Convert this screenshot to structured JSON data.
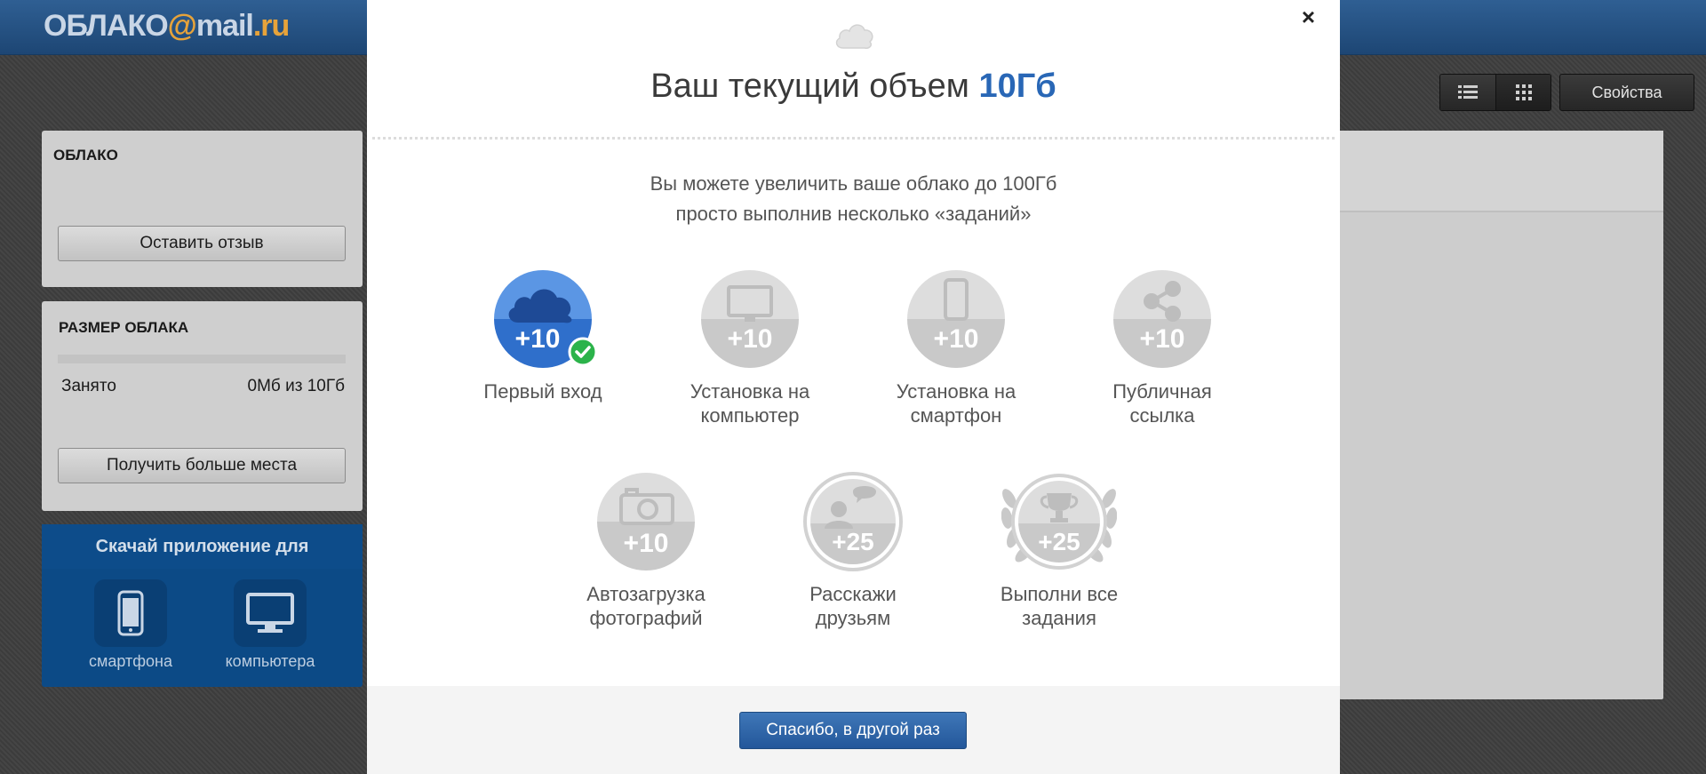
{
  "header": {
    "logo": {
      "part1": "ОБЛАКО",
      "at": "@",
      "part2": "mail",
      "part3": ".ru"
    }
  },
  "sidebar": {
    "cloud_panel": {
      "title": "ОБЛАКО",
      "feedback_button": "Оставить отзыв"
    },
    "size_panel": {
      "title": "РАЗМЕР ОБЛАКА",
      "used_label": "Занято",
      "used_value": "0Мб из 10Гб",
      "used_fraction": 0,
      "more_space_button": "Получить больше места"
    },
    "apps_panel": {
      "title": "Скачай приложение для",
      "items": [
        {
          "label": "смартфона",
          "icon": "smartphone-icon"
        },
        {
          "label": "компьютера",
          "icon": "monitor-icon"
        }
      ]
    }
  },
  "toolbar": {
    "view_list_icon": "list-icon",
    "view_grid_icon": "grid-icon",
    "properties_button": "Свойства"
  },
  "modal": {
    "title_prefix": "Ваш текущий объем ",
    "title_value": "10Гб",
    "subtitle_line1": "Вы можете увеличить ваше облако до 100Гб",
    "subtitle_line2": "просто выполнив несколько «заданий»",
    "tasks": [
      {
        "bonus": "+10",
        "label_line1": "Первый вход",
        "label_line2": "",
        "icon": "cloud-icon",
        "completed": true
      },
      {
        "bonus": "+10",
        "label_line1": "Установка на",
        "label_line2": "компьютер",
        "icon": "monitor-icon",
        "completed": false
      },
      {
        "bonus": "+10",
        "label_line1": "Установка на",
        "label_line2": "смартфон",
        "icon": "smartphone-icon",
        "completed": false
      },
      {
        "bonus": "+10",
        "label_line1": "Публичная",
        "label_line2": "ссылка",
        "icon": "share-icon",
        "completed": false
      },
      {
        "bonus": "+10",
        "label_line1": "Автозагрузка",
        "label_line2": "фотографий",
        "icon": "camera-icon",
        "completed": false
      },
      {
        "bonus": "+25",
        "label_line1": "Расскажи",
        "label_line2": "друзьям",
        "icon": "people-chat-icon",
        "completed": false
      },
      {
        "bonus": "+25",
        "label_line1": "Выполни все",
        "label_line2": "задания",
        "icon": "trophy-icon",
        "completed": false
      }
    ],
    "footer_button": "Спасибо, в другой раз"
  },
  "colors": {
    "accent": "#2967b6",
    "header_bg": "#2b5a8e",
    "completed_badge": "#2bb34a",
    "task_active": "#3f7fd6",
    "task_inactive": "#cfcfcf"
  }
}
